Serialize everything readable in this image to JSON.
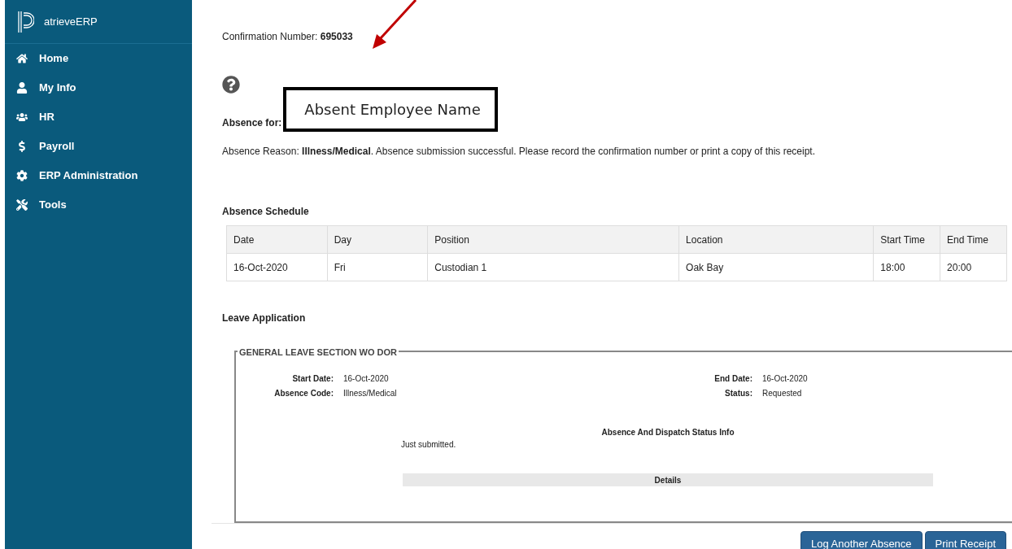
{
  "sidebar": {
    "brand": "atrieveERP",
    "items": [
      {
        "label": "Home"
      },
      {
        "label": "My Info"
      },
      {
        "label": "HR"
      },
      {
        "label": "Payroll"
      },
      {
        "label": "ERP Administration"
      },
      {
        "label": "Tools"
      }
    ]
  },
  "confirmation": {
    "label": "Confirmation Number:",
    "value": "695033"
  },
  "absence_for": {
    "label": "Absence for:",
    "name": "Absent Employee Name"
  },
  "message": "Absence Reason: **Illness/Medical**. Absence submission successful. Please record the confirmation number or print a copy of this receipt.",
  "schedule": {
    "title": "Absence Schedule",
    "columns": [
      "Date",
      "Day",
      "Position",
      "Location",
      "Start Time",
      "End Time"
    ],
    "rows": [
      [
        "16-Oct-2020",
        "Fri",
        "Custodian 1",
        "Oak Bay",
        "18:00",
        "20:00"
      ]
    ]
  },
  "leave": {
    "title": "Leave Application",
    "section": "GENERAL LEAVE SECTION WO DOR",
    "fields": [
      {
        "label": "Start Date:",
        "value": "16-Oct-2020"
      },
      {
        "label": "End Date:",
        "value": "16-Oct-2020"
      },
      {
        "label": "Absence Code:",
        "value": "Illness/Medical"
      },
      {
        "label": "Status:",
        "value": "Requested"
      }
    ],
    "status_title": "Absence And Dispatch Status Info",
    "status_text": "Just submitted.",
    "details": "Details"
  },
  "buttons": [
    "Log Another Absence",
    "Print Receipt"
  ]
}
